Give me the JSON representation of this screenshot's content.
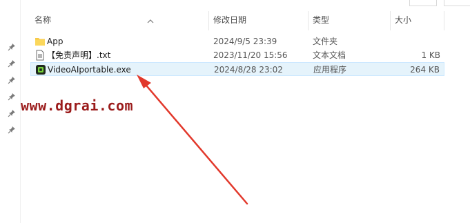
{
  "columns": {
    "name": "名称",
    "modified": "修改日期",
    "type": "类型",
    "size": "大小"
  },
  "files": [
    {
      "name": "App",
      "modified": "2024/9/5 23:39",
      "type": "文件夹",
      "size": "",
      "icon": "folder-icon"
    },
    {
      "name": "【免责声明】.txt",
      "modified": "2023/11/20 15:56",
      "type": "文本文档",
      "size": "1 KB",
      "icon": "text-file-icon"
    },
    {
      "name": "VideoAIportable.exe",
      "modified": "2024/8/28 23:02",
      "type": "应用程序",
      "size": "264 KB",
      "icon": "app-exe-icon",
      "selected": true
    }
  ],
  "watermark": "www.dgrai.com",
  "colors": {
    "selection": "#e5f3fb",
    "folder": "#f7c948",
    "annotation_arrow": "#e2382b",
    "watermark": "#9b1c1c"
  }
}
